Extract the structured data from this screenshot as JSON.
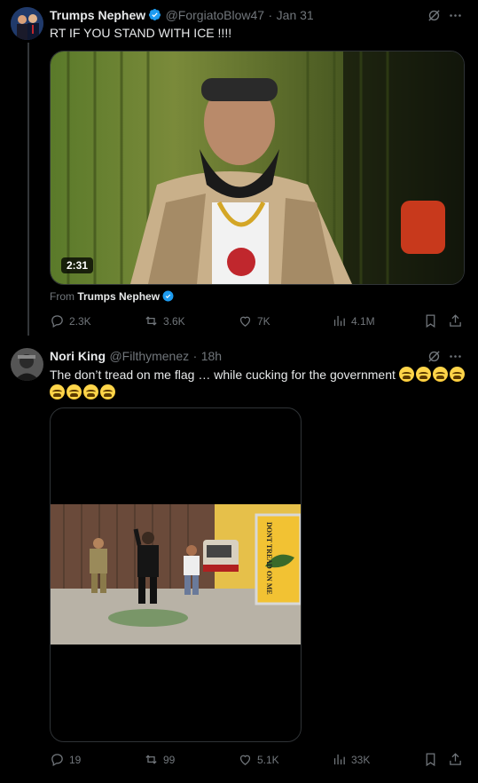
{
  "tweet1": {
    "name": "Trumps Nephew",
    "handle": "@ForgiatoBlow47",
    "sep": "·",
    "time": "Jan 31",
    "text": "RT IF YOU STAND WITH ICE !!!!",
    "video_duration": "2:31",
    "from_prefix": "From",
    "from_name": "Trumps Nephew",
    "stats": {
      "replies": "2.3K",
      "reposts": "3.6K",
      "likes": "7K",
      "views": "4.1M"
    }
  },
  "tweet2": {
    "name": "Nori King",
    "handle": "@Filthymenez",
    "sep": "·",
    "time": "18h",
    "text_line1": "The don’t tread on me flag … while cucking for the government",
    "flag_text": "DONT TREAD ON ME",
    "stats": {
      "replies": "19",
      "reposts": "99",
      "likes": "5.1K",
      "views": "33K"
    }
  },
  "colors": {
    "background": "#000000",
    "text": "#e7e9ea",
    "muted": "#71767b",
    "verified": "#1d9bf0",
    "border": "#2f3336"
  },
  "icons": [
    "grok-icon",
    "more-icon",
    "reply-icon",
    "repost-icon",
    "like-icon",
    "views-icon",
    "bookmark-icon",
    "share-icon",
    "verified-badge-icon",
    "loudly-crying-face-emoji"
  ]
}
